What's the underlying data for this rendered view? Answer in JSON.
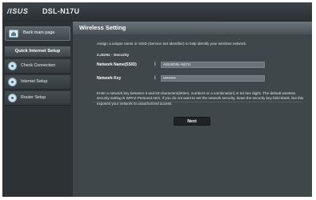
{
  "header": {
    "brand": "/ISUS",
    "model": "DSL-N17U"
  },
  "sidebar": {
    "back_label": "Back main page",
    "quick_setup_title": "Quick Internet Setup",
    "items": [
      {
        "label": "Check Connection",
        "icon": "globe-icon"
      },
      {
        "label": "Internet Setup",
        "icon": "globe-icon"
      },
      {
        "label": "Router Setup",
        "icon": "globe-icon"
      }
    ]
  },
  "main": {
    "title": "Wireless Setting",
    "intro": "Assign a unique name or SSID (Service Set Identifier) to help identify your wireless network.",
    "section": "2.4GHz - Security",
    "fields": [
      {
        "label": "Network Name(SSID)",
        "value": "ASUSDSL-N17U"
      },
      {
        "label": "Network Key",
        "value": "••••••••••"
      }
    ],
    "description": "Enter a network key between 8 and 63 characters(letters, numbers or a combination) or 64 hex digits. The default wireless security setting is WPA2-Personal AES. If you do not want to set the network security, leave the security key field blank, but this exposes your network to unauthorized access.",
    "next_label": "Next"
  }
}
